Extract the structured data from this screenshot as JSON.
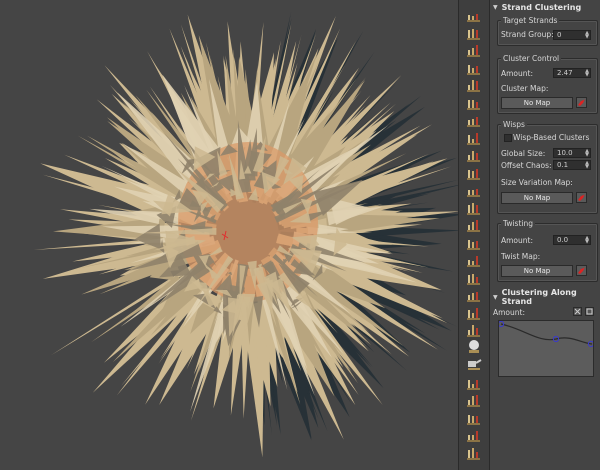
{
  "viewport": {
    "name": "hair-viewport",
    "colors": {
      "background": "#454545",
      "hair_light": "#cdb991",
      "hair_shadow": "#273137",
      "core": "#d99a68"
    }
  },
  "toolstrip": {
    "icons": [
      "brush-icon",
      "brush-icon",
      "comb-icon",
      "strand-icon",
      "strand-icon",
      "strand-icon",
      "strand-icon",
      "strand-icon",
      "strand-icon",
      "strand-icon",
      "strand-icon",
      "strand-icon",
      "strand-icon",
      "strand-icon",
      "strand-icon",
      "strand-icon",
      "strand-icon",
      "strand-icon",
      "strand-icon",
      "sphere-icon",
      "paint-icon",
      "strand-icon",
      "strand-icon",
      "strand-icon",
      "strand-icon",
      "strand-icon"
    ]
  },
  "panel": {
    "strand_clustering": {
      "title": "Strand Clustering",
      "target": {
        "title": "Target Strands",
        "strand_group_label": "Strand Group:",
        "strand_group_value": "0"
      },
      "cluster": {
        "title": "Cluster Control",
        "amount_label": "Amount:",
        "amount_value": "2.47",
        "map_label": "Cluster Map:",
        "map_button": "No Map"
      },
      "wisps": {
        "title": "Wisps",
        "checkbox_label": "Wisp-Based Clusters",
        "global_size_label": "Global Size:",
        "global_size_value": "10.0",
        "offset_chaos_label": "Offset Chaos:",
        "offset_chaos_value": "0.1",
        "size_map_label": "Size Variation Map:",
        "map_button": "No Map"
      },
      "twisting": {
        "title": "Twisting",
        "amount_label": "Amount:",
        "amount_value": "0.0",
        "map_label": "Twist Map:",
        "map_button": "No Map"
      }
    },
    "along_strand": {
      "title": "Clustering Along Strand",
      "amount_label": "Amount:"
    }
  }
}
